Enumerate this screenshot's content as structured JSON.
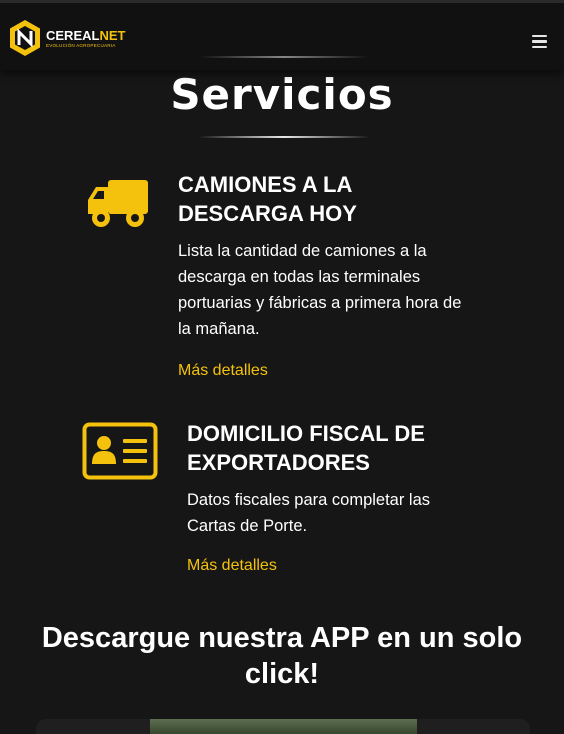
{
  "brand": {
    "name_part1": "CEREAL",
    "name_part2": "NET",
    "tagline": "EVOLUCIÓN AGROPECUARIA",
    "accent_color": "#f4c20d"
  },
  "nav": {
    "menu_icon": "hamburger-menu-icon"
  },
  "services": {
    "title": "Servicios",
    "items": [
      {
        "icon": "truck-icon",
        "title_line1": "CAMIONES A LA",
        "title_line2": "DESCARGA HOY",
        "desc_line1": "Lista la cantidad de camiones a la",
        "desc_line2": "descarga en todas las terminales",
        "desc_line3": "portuarias y fábricas a primera hora de",
        "desc_line4": "la mañana.",
        "link": "Más detalles"
      },
      {
        "icon": "id-card-icon",
        "title_line1": "DOMICILIO FISCAL DE",
        "title_line2": "EXPORTADORES",
        "desc_line1": "Datos fiscales para completar las",
        "desc_line2": "Cartas de Porte.",
        "link": "Más detalles"
      }
    ]
  },
  "app_section": {
    "title_line1": "Descargue nuestra APP en un solo",
    "title_line2": "click!"
  }
}
